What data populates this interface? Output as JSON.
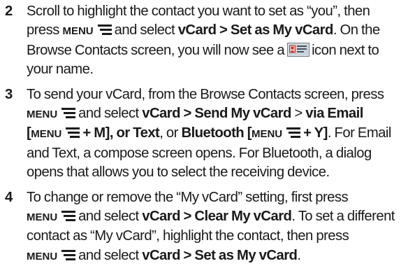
{
  "steps": [
    {
      "number": "2",
      "segments": {
        "t1": "Scroll to highlight the contact you want to set as “you”, then",
        "t2": "press",
        "k1": "MENU",
        "t3": "and select",
        "b1": "vCard > Set as My vCard",
        "t4": ". On the",
        "t5": "Browse Contacts screen, you will now see a",
        "t6": "icon next to",
        "t7": "your name."
      }
    },
    {
      "number": "3",
      "segments": {
        "t1": "To send your vCard, from the Browse Contacts screen, press",
        "k1": "MENU",
        "t2": "and select",
        "b1": "vCard > Send My vCard",
        "t3": "> ",
        "b2": "via Email",
        "t4": "[",
        "k2": "MENU",
        "b3": "+ M]",
        "t5": ", or ",
        "b4": "Text",
        "t6": ", or ",
        "b5": "Bluetooth",
        "t7": " [",
        "k3": "MENU",
        "b6": "+ Y]",
        "t8": ". For Email",
        "t9": "and Text, a compose screen opens. For Bluetooth, a dialog",
        "t10": "opens that allows you to select the receiving device."
      }
    },
    {
      "number": "4",
      "segments": {
        "t1": "To change or remove the “My vCard” setting, first press",
        "k1": "MENU",
        "t2": "and select",
        "b1": "vCard > Clear My vCard",
        "t3": ". To set a different",
        "t4": "contact as “My vCard”, highlight the contact, then press",
        "k2": "MENU",
        "t5": "and select",
        "b2": "vCard > Set as My vCard",
        "t6": "."
      }
    }
  ],
  "icons": {
    "menu": "menu-icon",
    "vcard": "vcard-icon"
  }
}
